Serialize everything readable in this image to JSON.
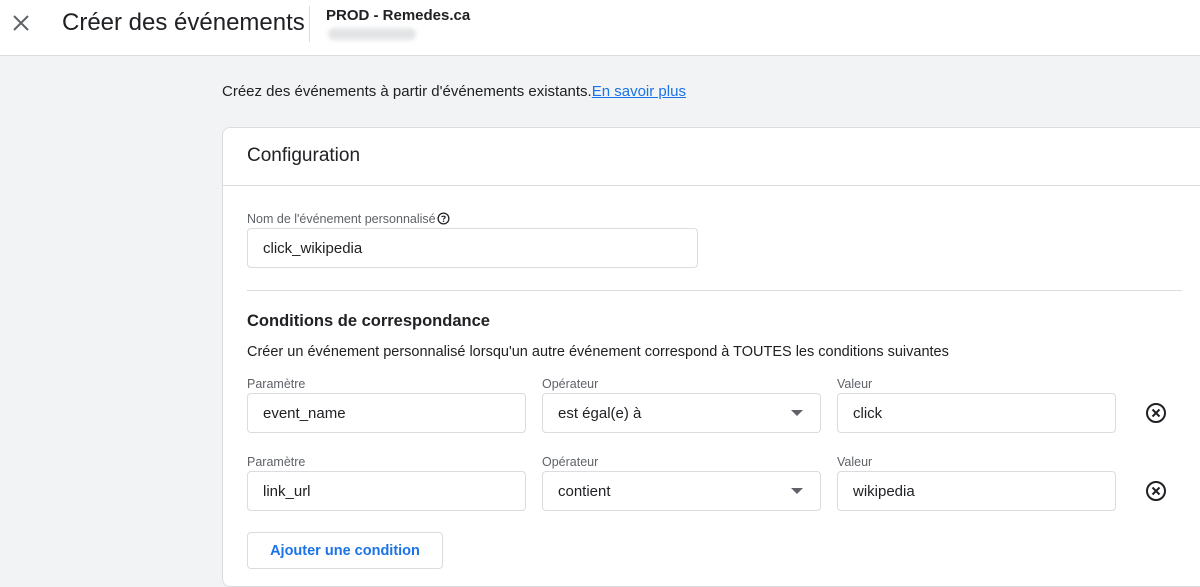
{
  "header": {
    "title": "Créer des événements",
    "property_name": "PROD - Remedes.ca"
  },
  "intro": {
    "text": "Créez des événements à partir d'événements existants.",
    "link": "En savoir plus"
  },
  "configuration": {
    "title": "Configuration",
    "event_name_label": "Nom de l'événement personnalisé",
    "event_name_value": "click_wikipedia"
  },
  "conditions": {
    "title": "Conditions de correspondance",
    "description": "Créer un événement personnalisé lorsqu'un autre événement correspond à TOUTES les conditions suivantes",
    "rows": [
      {
        "param_label": "Paramètre",
        "param_value": "event_name",
        "operator_label": "Opérateur",
        "operator_value": "est égal(e) à",
        "value_label": "Valeur",
        "value_value": "click"
      },
      {
        "param_label": "Paramètre",
        "param_value": "link_url",
        "operator_label": "Opérateur",
        "operator_value": "contient",
        "value_label": "Valeur",
        "value_value": "wikipedia"
      }
    ],
    "add_button": "Ajouter une condition"
  },
  "icons": {
    "close": "close-icon",
    "help": "help-circle-icon",
    "dropdown": "dropdown-arrow-icon",
    "remove": "remove-circle-icon"
  },
  "colors": {
    "link": "#1a73e8",
    "background": "#f1f3f4",
    "border": "#dadce0"
  }
}
